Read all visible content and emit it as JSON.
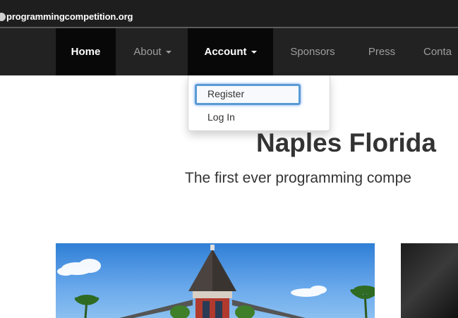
{
  "browser": {
    "url": "programmingcompetition.org"
  },
  "navbar": {
    "items": [
      {
        "label": "Home",
        "active": true,
        "dropdown": false
      },
      {
        "label": "About",
        "active": false,
        "dropdown": true
      },
      {
        "label": "Account",
        "active": true,
        "dropdown": true
      },
      {
        "label": "Sponsors",
        "active": false,
        "dropdown": false
      },
      {
        "label": "Press",
        "active": false,
        "dropdown": false
      },
      {
        "label": "Conta",
        "active": false,
        "dropdown": false
      }
    ]
  },
  "account_menu": {
    "items": [
      {
        "label": "Register",
        "focused": true
      },
      {
        "label": "Log In",
        "focused": false
      }
    ]
  },
  "hero": {
    "title": "Naples Florida",
    "subtitle": "The first ever programming compe"
  },
  "colors": {
    "navbar_bg": "#222222",
    "active_bg": "#080808",
    "focus_ring": "#5b9bd5",
    "text_dark": "#333333"
  }
}
